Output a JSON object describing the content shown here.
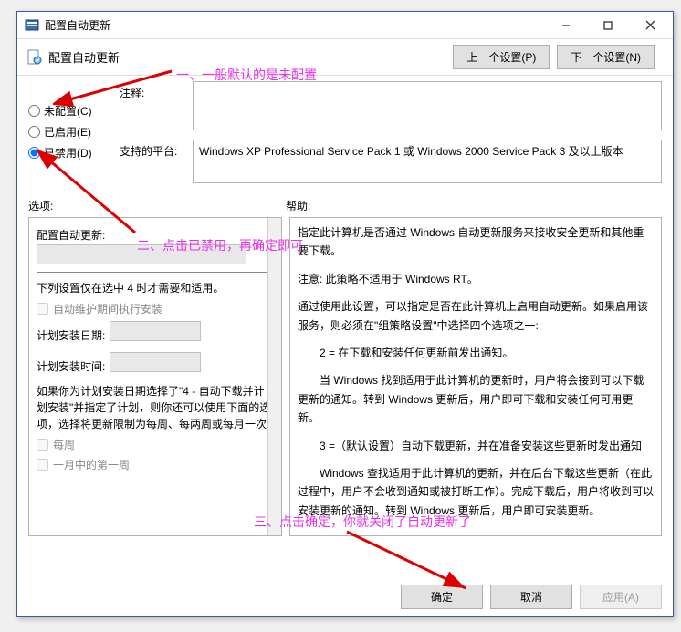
{
  "window": {
    "title": "配置自动更新",
    "subtitle": "配置自动更新"
  },
  "nav": {
    "prev": "上一个设置(P)",
    "next": "下一个设置(N)"
  },
  "radios": {
    "unconfigured": "未配置(C)",
    "enabled": "已启用(E)",
    "disabled": "已禁用(D)"
  },
  "labels": {
    "comment": "注释:",
    "platform": "支持的平台:",
    "options": "选项:",
    "help": "帮助:"
  },
  "platform_text": "Windows XP Professional Service Pack 1 或 Windows 2000 Service Pack 3 及以上版本",
  "options_panel": {
    "header": "配置自动更新:",
    "note": "下列设置仅在选中 4 时才需要和适用。",
    "chk_maint": "自动维护期间执行安装",
    "sched_date": "计划安装日期:",
    "sched_time": "计划安装时间:",
    "long_note": "如果你为计划安装日期选择了\"4 - 自动下载并计划安装\"并指定了计划，则你还可以使用下面的选项，选择将更新限制为每周、每两周或每月一次:",
    "chk_weekly": "每周",
    "chk_first_week": "一月中的第一周"
  },
  "help_panel": {
    "p1": "指定此计算机是否通过 Windows 自动更新服务来接收安全更新和其他重要下载。",
    "p2": "注意: 此策略不适用于 Windows RT。",
    "p3": "通过使用此设置，可以指定是否在此计算机上启用自动更新。如果启用该服务，则必须在\"组策略设置\"中选择四个选项之一:",
    "p4": "2 = 在下载和安装任何更新前发出通知。",
    "p5": "当 Windows 找到适用于此计算机的更新时，用户将会接到可以下载更新的通知。转到 Windows 更新后，用户即可下载和安装任何可用更新。",
    "p6": "3 =（默认设置）自动下载更新，并在准备安装这些更新时发出通知",
    "p7": "Windows 查找适用于此计算机的更新，并在后台下载这些更新（在此过程中，用户不会收到通知或被打断工作）。完成下载后，用户将收到可以安装更新的通知。转到 Windows 更新后，用户即可安装更新。"
  },
  "footer": {
    "ok": "确定",
    "cancel": "取消",
    "apply": "应用(A)"
  },
  "annotations": {
    "a1": "一、一般默认的是未配置",
    "a2": "二、点击已禁用，再确定即可",
    "a3": "三、点击确定，你就关闭了自动更新了"
  }
}
